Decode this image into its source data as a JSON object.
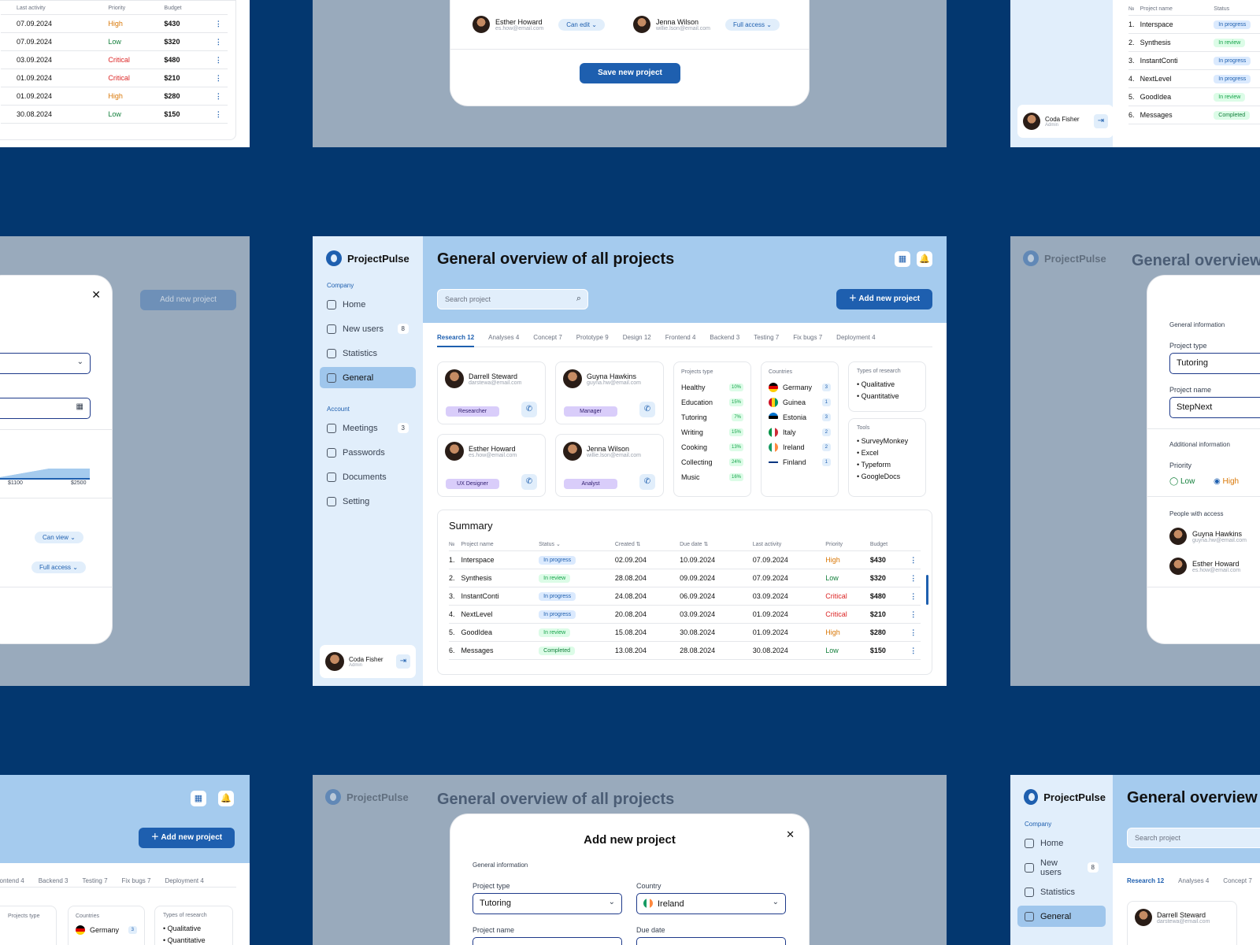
{
  "app": {
    "brand": "ProjectPulse"
  },
  "sidebar": {
    "company_label": "Company",
    "account_label": "Account",
    "company_items": [
      {
        "label": "Home",
        "icon": "home-icon",
        "count": ""
      },
      {
        "label": "New users",
        "icon": "user-plus-icon",
        "count": "8"
      },
      {
        "label": "Statistics",
        "icon": "chart-icon",
        "count": ""
      },
      {
        "label": "General",
        "icon": "globe-icon",
        "count": "",
        "active": true
      }
    ],
    "account_items": [
      {
        "label": "Meetings",
        "icon": "calendar-icon",
        "count": "3"
      },
      {
        "label": "Passwords",
        "icon": "key-icon",
        "count": ""
      },
      {
        "label": "Documents",
        "icon": "document-icon",
        "count": ""
      },
      {
        "label": "Setting",
        "icon": "gear-icon",
        "count": ""
      }
    ],
    "user": {
      "name": "Coda Fisher",
      "role": "Admin"
    }
  },
  "header": {
    "title": "General overview of all projects",
    "search_placeholder": "Search project",
    "add_button": "Add new project"
  },
  "tabs": [
    "Research 12",
    "Analyses 4",
    "Concept 7",
    "Prototype 9",
    "Design 12",
    "Frontend 4",
    "Backend 3",
    "Testing 7",
    "Fix bugs 7",
    "Deployment 4"
  ],
  "people": [
    {
      "name": "Darrell Steward",
      "email": "darstewa@email.com",
      "role": "Researcher"
    },
    {
      "name": "Guyna Hawkins",
      "email": "guyna.hw@email.com",
      "role": "Manager"
    },
    {
      "name": "Esther Howard",
      "email": "es.how@email.com",
      "role": "UX Designer"
    },
    {
      "name": "Jenna Wilson",
      "email": "willie.lson@email.com",
      "role": "Analyst"
    }
  ],
  "project_types": {
    "title": "Projects type",
    "items": [
      {
        "label": "Healthy",
        "pct": "10%"
      },
      {
        "label": "Education",
        "pct": "15%"
      },
      {
        "label": "Tutoring",
        "pct": "7%"
      },
      {
        "label": "Writing",
        "pct": "15%"
      },
      {
        "label": "Cooking",
        "pct": "13%"
      },
      {
        "label": "Collecting",
        "pct": "24%"
      },
      {
        "label": "Music",
        "pct": "16%"
      }
    ]
  },
  "countries": {
    "title": "Countries",
    "items": [
      {
        "label": "Germany",
        "count": "3"
      },
      {
        "label": "Guinea",
        "count": "1"
      },
      {
        "label": "Estonia",
        "count": "3"
      },
      {
        "label": "Italy",
        "count": "2"
      },
      {
        "label": "Ireland",
        "count": "2"
      },
      {
        "label": "Finland",
        "count": "1"
      }
    ]
  },
  "research_types": {
    "title": "Types of research",
    "items": [
      "Qualitative",
      "Quantitative"
    ]
  },
  "tools": {
    "title": "Tools",
    "items": [
      "SurveyMonkey",
      "Excel",
      "Typeform",
      "GoogleDocs"
    ]
  },
  "summary": {
    "title": "Summary",
    "columns": [
      "№",
      "Project name",
      "Status",
      "Created",
      "Due date",
      "Last activity",
      "Priority",
      "Budget"
    ],
    "rows": [
      {
        "n": "1.",
        "name": "Interspace",
        "status": "In progress",
        "created": "02.09.204",
        "due": "10.09.2024",
        "last": "07.09.2024",
        "priority": "High",
        "budget": "$430"
      },
      {
        "n": "2.",
        "name": "Synthesis",
        "status": "In review",
        "created": "28.08.204",
        "due": "09.09.2024",
        "last": "07.09.2024",
        "priority": "Low",
        "budget": "$320"
      },
      {
        "n": "3.",
        "name": "InstantConti",
        "status": "In progress",
        "created": "24.08.204",
        "due": "06.09.2024",
        "last": "03.09.2024",
        "priority": "Critical",
        "budget": "$480"
      },
      {
        "n": "4.",
        "name": "NextLevel",
        "status": "In progress",
        "created": "20.08.204",
        "due": "03.09.2024",
        "last": "01.09.2024",
        "priority": "Critical",
        "budget": "$210"
      },
      {
        "n": "5.",
        "name": "GoodIdea",
        "status": "In review",
        "created": "15.08.204",
        "due": "30.08.2024",
        "last": "01.09.2024",
        "priority": "High",
        "budget": "$280"
      },
      {
        "n": "6.",
        "name": "Messages",
        "status": "Completed",
        "created": "13.08.204",
        "due": "28.08.2024",
        "last": "30.08.2024",
        "priority": "Low",
        "budget": "$150"
      }
    ]
  },
  "modal": {
    "title": "Add new project",
    "general_info": "General information",
    "project_type_label": "Project type",
    "project_type_value": "Tutoring",
    "country_label": "Country",
    "country_value": "Ireland",
    "project_name_label": "Project name",
    "project_name_value": "StepNext",
    "due_date_label": "Due date",
    "additional_info": "Additional information",
    "priority_label": "Priority",
    "priority_low": "Low",
    "priority_high": "High",
    "people_access": "People with access",
    "save_button": "Save new project",
    "can_edit": "Can edit",
    "full_access": "Full access",
    "can_view": "Can view",
    "range_min": "$1100",
    "range_max": "$2500"
  },
  "colors": {
    "brand": "#1e5faf",
    "background": "#03376f",
    "sidebar": "#e1eefb",
    "hero": "#a5cbee"
  }
}
